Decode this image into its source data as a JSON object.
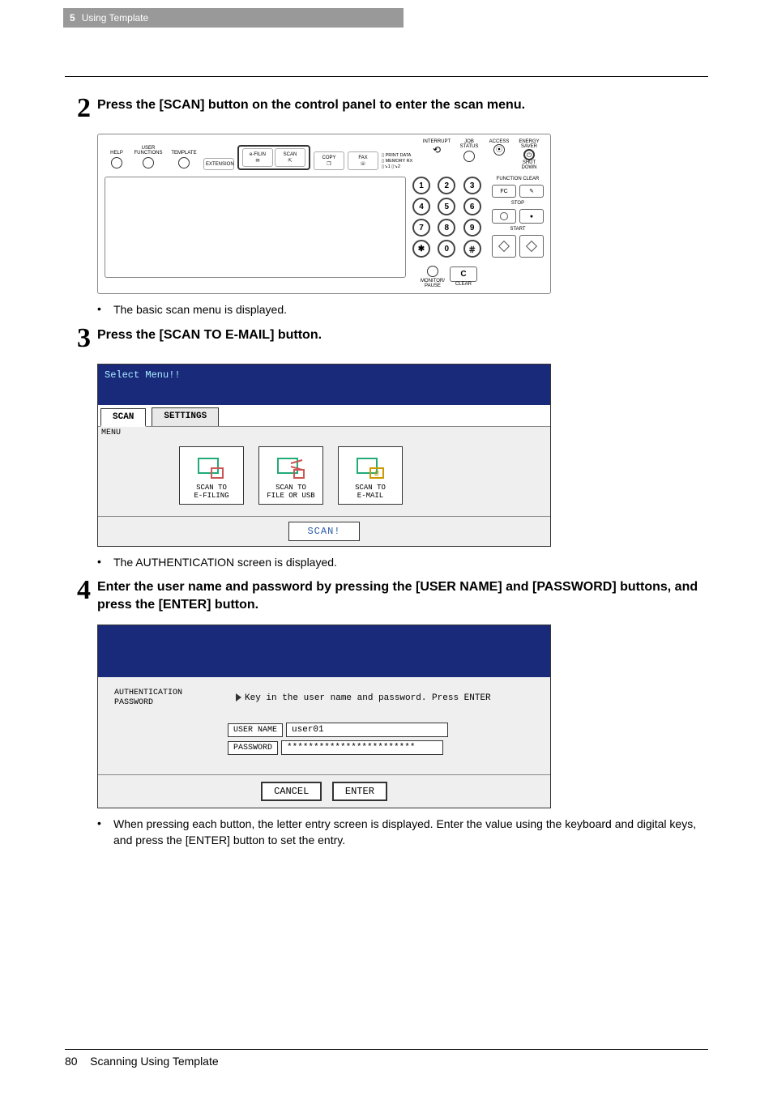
{
  "header": {
    "chapter_num": "5",
    "chapter_title": "Using Template"
  },
  "steps": {
    "s2": {
      "num": "2",
      "title": "Press the [SCAN] button on the control panel to enter the scan menu.",
      "bullet": "The basic scan menu is displayed."
    },
    "s3": {
      "num": "3",
      "title": "Press the [SCAN TO E-MAIL] button.",
      "bullet": "The AUTHENTICATION screen is displayed."
    },
    "s4": {
      "num": "4",
      "title": "Enter the user name and password by pressing the [USER NAME] and [PASSWORD] buttons, and press the [ENTER] button.",
      "bullet": "When pressing each button, the letter entry screen is displayed.  Enter the value using the keyboard and digital keys, and press the [ENTER] button to set the entry."
    }
  },
  "fig1": {
    "labels": {
      "help": "HELP",
      "user_functions": "USER FUNCTIONS",
      "template": "TEMPLATE",
      "extension": "EXTENSION",
      "efilin": "e-FILIN",
      "scan": "SCAN",
      "copy": "COPY",
      "fax": "FAX",
      "print_data": "PRINT DATA",
      "memory_rx": "MEMORY RX",
      "interrupt": "INTERRUPT",
      "job_status": "JOB STATUS",
      "access": "ACCESS",
      "energy_saver_1": "ENERGY",
      "energy_saver_2": "SAVER",
      "shut_down": "SHUT DOWN",
      "function_clear": "FUNCTION CLEAR",
      "fc": "FC",
      "stop": "STOP",
      "start": "START",
      "monitor": "MONITOR/",
      "pause": "PAUSE",
      "clear": "CLEAR",
      "c": "C"
    },
    "keys": [
      "1",
      "2",
      "3",
      "4",
      "5",
      "6",
      "7",
      "8",
      "9",
      "✱",
      "0",
      "＃"
    ]
  },
  "fig2": {
    "topbar": "Select Menu!!",
    "tab_scan": "SCAN",
    "tab_settings": "SETTINGS",
    "menu_label": "MENU",
    "opt1_l1": "SCAN TO",
    "opt1_l2": "E-FILING",
    "opt2_l1": "SCAN TO",
    "opt2_l2": "FILE OR USB",
    "opt3_l1": "SCAN TO",
    "opt3_l2": "E-MAIL",
    "scan_btn": "SCAN!"
  },
  "fig3": {
    "left_l1": "AUTHENTICATION",
    "left_l2": "PASSWORD",
    "keyin": "Key in the user name and password. Press ENTER",
    "username_btn": "USER NAME",
    "username_val": "user01",
    "password_btn": "PASSWORD",
    "password_val": "************************",
    "cancel": "CANCEL",
    "enter": "ENTER"
  },
  "footer": {
    "page_num": "80",
    "section": "Scanning Using Template"
  }
}
